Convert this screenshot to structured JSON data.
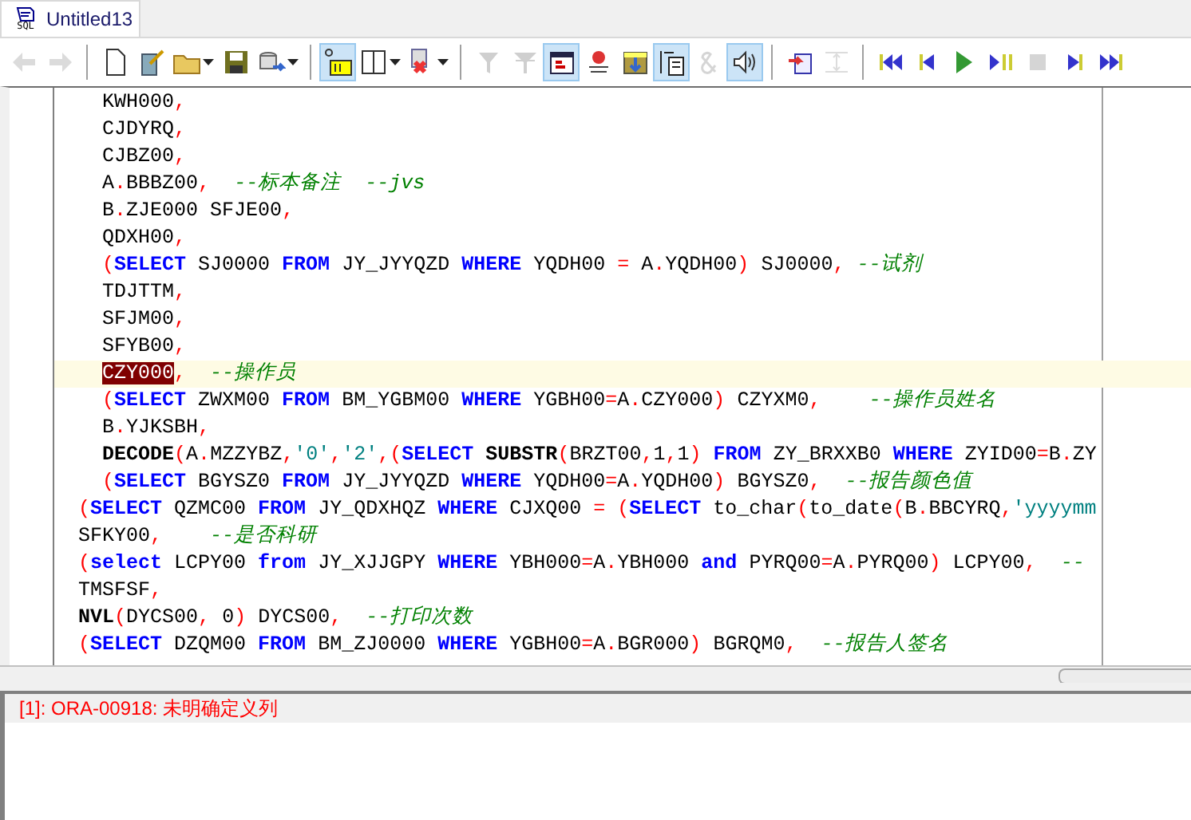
{
  "tab": {
    "title": "Untitled13",
    "icon_label": "SQL",
    "selected": true
  },
  "toolbar": [
    [
      {
        "pressed": false,
        "disabled": true,
        "dropdown": false
      },
      {
        "pressed": false,
        "disabled": true,
        "dropdown": false
      }
    ],
    [
      {
        "pressed": false,
        "disabled": false,
        "dropdown": false
      },
      {
        "pressed": false,
        "disabled": false,
        "dropdown": false
      },
      {
        "pressed": false,
        "disabled": false,
        "dropdown": true
      },
      {
        "pressed": false,
        "disabled": false,
        "dropdown": false
      },
      {
        "pressed": false,
        "disabled": false,
        "dropdown": true
      }
    ],
    [
      {
        "pressed": true,
        "disabled": false,
        "dropdown": false
      },
      {
        "pressed": false,
        "disabled": false,
        "dropdown": true
      },
      {
        "pressed": false,
        "disabled": false,
        "dropdown": true
      }
    ],
    [
      {
        "pressed": false,
        "disabled": true,
        "dropdown": false
      },
      {
        "pressed": false,
        "disabled": true,
        "dropdown": false
      },
      {
        "pressed": true,
        "disabled": false,
        "dropdown": false
      },
      {
        "pressed": false,
        "disabled": false,
        "dropdown": false
      },
      {
        "pressed": false,
        "disabled": false,
        "dropdown": false
      },
      {
        "pressed": true,
        "disabled": false,
        "dropdown": false
      },
      {
        "pressed": false,
        "disabled": true,
        "dropdown": false
      },
      {
        "pressed": true,
        "disabled": false,
        "dropdown": false
      }
    ],
    [
      {
        "pressed": false,
        "disabled": false,
        "dropdown": false
      },
      {
        "pressed": false,
        "disabled": true,
        "dropdown": false
      }
    ],
    [
      {
        "pressed": false,
        "disabled": false,
        "dropdown": false
      },
      {
        "pressed": false,
        "disabled": false,
        "dropdown": false
      },
      {
        "pressed": false,
        "disabled": false,
        "dropdown": false
      },
      {
        "pressed": false,
        "disabled": false,
        "dropdown": false
      },
      {
        "pressed": false,
        "disabled": true,
        "dropdown": false
      },
      {
        "pressed": false,
        "disabled": false,
        "dropdown": false
      },
      {
        "pressed": false,
        "disabled": false,
        "dropdown": false
      }
    ]
  ],
  "editor": {
    "lines": [
      {
        "deep": true,
        "current": false,
        "tokens": [
          {
            "kind": "t",
            "text": "KWH000"
          },
          {
            "kind": "p",
            "text": ","
          }
        ]
      },
      {
        "deep": true,
        "current": false,
        "tokens": [
          {
            "kind": "t",
            "text": "CJDYRQ"
          },
          {
            "kind": "p",
            "text": ","
          }
        ]
      },
      {
        "deep": true,
        "current": false,
        "tokens": [
          {
            "kind": "t",
            "text": "CJBZ00"
          },
          {
            "kind": "p",
            "text": ","
          }
        ]
      },
      {
        "deep": true,
        "current": false,
        "tokens": [
          {
            "kind": "t",
            "text": "A"
          },
          {
            "kind": "p",
            "text": "."
          },
          {
            "kind": "t",
            "text": "BBBZ00"
          },
          {
            "kind": "p",
            "text": ","
          },
          {
            "kind": "c",
            "text": "  --标本备注  --jvs"
          }
        ]
      },
      {
        "deep": true,
        "current": false,
        "tokens": [
          {
            "kind": "t",
            "text": "B"
          },
          {
            "kind": "p",
            "text": "."
          },
          {
            "kind": "t",
            "text": "ZJE000 SFJE00"
          },
          {
            "kind": "p",
            "text": ","
          }
        ]
      },
      {
        "deep": true,
        "current": false,
        "tokens": [
          {
            "kind": "t",
            "text": "QDXH00"
          },
          {
            "kind": "p",
            "text": ","
          }
        ]
      },
      {
        "deep": true,
        "current": false,
        "tokens": [
          {
            "kind": "p",
            "text": "("
          },
          {
            "kind": "k",
            "text": "SELECT"
          },
          {
            "kind": "t",
            "text": " SJ0000 "
          },
          {
            "kind": "k",
            "text": "FROM"
          },
          {
            "kind": "t",
            "text": " JY_JYYQZD "
          },
          {
            "kind": "k",
            "text": "WHERE"
          },
          {
            "kind": "t",
            "text": " YQDH00 "
          },
          {
            "kind": "p",
            "text": "="
          },
          {
            "kind": "t",
            "text": " A"
          },
          {
            "kind": "p",
            "text": "."
          },
          {
            "kind": "t",
            "text": "YQDH00"
          },
          {
            "kind": "p",
            "text": ")"
          },
          {
            "kind": "t",
            "text": " SJ0000"
          },
          {
            "kind": "p",
            "text": ","
          },
          {
            "kind": "c",
            "text": " --试剂"
          }
        ]
      },
      {
        "deep": true,
        "current": false,
        "tokens": [
          {
            "kind": "t",
            "text": "TDJTTM"
          },
          {
            "kind": "p",
            "text": ","
          }
        ]
      },
      {
        "deep": true,
        "current": false,
        "tokens": [
          {
            "kind": "t",
            "text": "SFJM00"
          },
          {
            "kind": "p",
            "text": ","
          }
        ]
      },
      {
        "deep": true,
        "current": false,
        "tokens": [
          {
            "kind": "t",
            "text": "SFYB00"
          },
          {
            "kind": "p",
            "text": ","
          }
        ]
      },
      {
        "deep": true,
        "current": true,
        "tokens": [
          {
            "kind": "h",
            "text": "CZY000"
          },
          {
            "kind": "p",
            "text": ","
          },
          {
            "kind": "c",
            "text": "  --操作员"
          }
        ]
      },
      {
        "deep": true,
        "current": false,
        "tokens": [
          {
            "kind": "p",
            "text": "("
          },
          {
            "kind": "k",
            "text": "SELECT"
          },
          {
            "kind": "t",
            "text": " ZWXM00 "
          },
          {
            "kind": "k",
            "text": "FROM"
          },
          {
            "kind": "t",
            "text": " BM_YGBM00 "
          },
          {
            "kind": "k",
            "text": "WHERE"
          },
          {
            "kind": "t",
            "text": " YGBH00"
          },
          {
            "kind": "p",
            "text": "="
          },
          {
            "kind": "t",
            "text": "A"
          },
          {
            "kind": "p",
            "text": "."
          },
          {
            "kind": "t",
            "text": "CZY000"
          },
          {
            "kind": "p",
            "text": ")"
          },
          {
            "kind": "t",
            "text": " CZYXM0"
          },
          {
            "kind": "p",
            "text": ","
          },
          {
            "kind": "c",
            "text": "    --操作员姓名"
          }
        ]
      },
      {
        "deep": true,
        "current": false,
        "tokens": [
          {
            "kind": "t",
            "text": "B"
          },
          {
            "kind": "p",
            "text": "."
          },
          {
            "kind": "t",
            "text": "YJKSBH"
          },
          {
            "kind": "p",
            "text": ","
          }
        ]
      },
      {
        "deep": true,
        "current": false,
        "tokens": [
          {
            "kind": "b",
            "text": "DECODE"
          },
          {
            "kind": "p",
            "text": "("
          },
          {
            "kind": "t",
            "text": "A"
          },
          {
            "kind": "p",
            "text": "."
          },
          {
            "kind": "t",
            "text": "MZZYBZ"
          },
          {
            "kind": "p",
            "text": ","
          },
          {
            "kind": "s",
            "text": "'0'"
          },
          {
            "kind": "p",
            "text": ","
          },
          {
            "kind": "s",
            "text": "'2'"
          },
          {
            "kind": "p",
            "text": ",("
          },
          {
            "kind": "k",
            "text": "SELECT"
          },
          {
            "kind": "b",
            "text": " SUBSTR"
          },
          {
            "kind": "p",
            "text": "("
          },
          {
            "kind": "t",
            "text": "BRZT00"
          },
          {
            "kind": "p",
            "text": ","
          },
          {
            "kind": "t",
            "text": "1"
          },
          {
            "kind": "p",
            "text": ","
          },
          {
            "kind": "t",
            "text": "1"
          },
          {
            "kind": "p",
            "text": ")"
          },
          {
            "kind": "k",
            "text": " FROM"
          },
          {
            "kind": "t",
            "text": " ZY_BRXXB0 "
          },
          {
            "kind": "k",
            "text": "WHERE"
          },
          {
            "kind": "t",
            "text": " ZYID00"
          },
          {
            "kind": "p",
            "text": "="
          },
          {
            "kind": "t",
            "text": "B"
          },
          {
            "kind": "p",
            "text": "."
          },
          {
            "kind": "t",
            "text": "ZY"
          }
        ]
      },
      {
        "deep": true,
        "current": false,
        "tokens": [
          {
            "kind": "p",
            "text": "("
          },
          {
            "kind": "k",
            "text": "SELECT"
          },
          {
            "kind": "t",
            "text": " BGYSZ0 "
          },
          {
            "kind": "k",
            "text": "FROM"
          },
          {
            "kind": "t",
            "text": " JY_JYYQZD "
          },
          {
            "kind": "k",
            "text": "WHERE"
          },
          {
            "kind": "t",
            "text": " YQDH00"
          },
          {
            "kind": "p",
            "text": "="
          },
          {
            "kind": "t",
            "text": "A"
          },
          {
            "kind": "p",
            "text": "."
          },
          {
            "kind": "t",
            "text": "YQDH00"
          },
          {
            "kind": "p",
            "text": ")"
          },
          {
            "kind": "t",
            "text": " BGYSZ0"
          },
          {
            "kind": "p",
            "text": ","
          },
          {
            "kind": "c",
            "text": "  --报告颜色值"
          }
        ]
      },
      {
        "deep": false,
        "current": false,
        "tokens": [
          {
            "kind": "p",
            "text": "("
          },
          {
            "kind": "k",
            "text": "SELECT"
          },
          {
            "kind": "t",
            "text": " QZMC00 "
          },
          {
            "kind": "k",
            "text": "FROM"
          },
          {
            "kind": "t",
            "text": " JY_QDXHQZ "
          },
          {
            "kind": "k",
            "text": "WHERE"
          },
          {
            "kind": "t",
            "text": " CJXQ00 "
          },
          {
            "kind": "p",
            "text": "= ("
          },
          {
            "kind": "k",
            "text": "SELECT"
          },
          {
            "kind": "t",
            "text": " to_char"
          },
          {
            "kind": "p",
            "text": "("
          },
          {
            "kind": "t",
            "text": "to_date"
          },
          {
            "kind": "p",
            "text": "("
          },
          {
            "kind": "t",
            "text": "B"
          },
          {
            "kind": "p",
            "text": "."
          },
          {
            "kind": "t",
            "text": "BBCYRQ"
          },
          {
            "kind": "p",
            "text": ","
          },
          {
            "kind": "s",
            "text": "'yyyymm"
          }
        ]
      },
      {
        "deep": false,
        "current": false,
        "tokens": [
          {
            "kind": "t",
            "text": "SFKY00"
          },
          {
            "kind": "p",
            "text": ","
          },
          {
            "kind": "c",
            "text": "    --是否科研"
          }
        ]
      },
      {
        "deep": false,
        "current": false,
        "tokens": [
          {
            "kind": "p",
            "text": "("
          },
          {
            "kind": "k",
            "text": "select"
          },
          {
            "kind": "t",
            "text": " LCPY00 "
          },
          {
            "kind": "k",
            "text": "from"
          },
          {
            "kind": "t",
            "text": " JY_XJJGPY "
          },
          {
            "kind": "k",
            "text": "WHERE"
          },
          {
            "kind": "t",
            "text": " YBH000"
          },
          {
            "kind": "p",
            "text": "="
          },
          {
            "kind": "t",
            "text": "A"
          },
          {
            "kind": "p",
            "text": "."
          },
          {
            "kind": "t",
            "text": "YBH000 "
          },
          {
            "kind": "k",
            "text": "and"
          },
          {
            "kind": "t",
            "text": " PYRQ00"
          },
          {
            "kind": "p",
            "text": "="
          },
          {
            "kind": "t",
            "text": "A"
          },
          {
            "kind": "p",
            "text": "."
          },
          {
            "kind": "t",
            "text": "PYRQ00"
          },
          {
            "kind": "p",
            "text": ")"
          },
          {
            "kind": "t",
            "text": " LCPY00"
          },
          {
            "kind": "p",
            "text": ","
          },
          {
            "kind": "c",
            "text": "  --"
          }
        ]
      },
      {
        "deep": false,
        "current": false,
        "tokens": [
          {
            "kind": "t",
            "text": "TMSFSF"
          },
          {
            "kind": "p",
            "text": ","
          }
        ]
      },
      {
        "deep": false,
        "current": false,
        "tokens": [
          {
            "kind": "b",
            "text": "NVL"
          },
          {
            "kind": "p",
            "text": "("
          },
          {
            "kind": "t",
            "text": "DYCS00"
          },
          {
            "kind": "p",
            "text": ","
          },
          {
            "kind": "t",
            "text": " 0"
          },
          {
            "kind": "p",
            "text": ")"
          },
          {
            "kind": "t",
            "text": " DYCS00"
          },
          {
            "kind": "p",
            "text": ","
          },
          {
            "kind": "c",
            "text": "  --打印次数"
          }
        ]
      },
      {
        "deep": false,
        "current": false,
        "tokens": [
          {
            "kind": "p",
            "text": "("
          },
          {
            "kind": "k",
            "text": "SELECT"
          },
          {
            "kind": "t",
            "text": " DZQM00 "
          },
          {
            "kind": "k",
            "text": "FROM"
          },
          {
            "kind": "t",
            "text": " BM_ZJ0000 "
          },
          {
            "kind": "k",
            "text": "WHERE"
          },
          {
            "kind": "t",
            "text": " YGBH00"
          },
          {
            "kind": "p",
            "text": "="
          },
          {
            "kind": "t",
            "text": "A"
          },
          {
            "kind": "p",
            "text": "."
          },
          {
            "kind": "t",
            "text": "BGR000"
          },
          {
            "kind": "p",
            "text": ")"
          },
          {
            "kind": "t",
            "text": " BGRQM0"
          },
          {
            "kind": "p",
            "text": ","
          },
          {
            "kind": "c",
            "text": "  --报告人签名"
          }
        ]
      }
    ]
  },
  "output": {
    "messages": [
      "[1]: ORA-00918: 未明确定义列"
    ]
  }
}
